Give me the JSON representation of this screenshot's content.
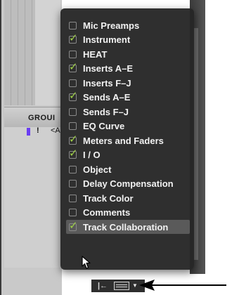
{
  "groups": {
    "header": "GROUI",
    "row_flag": "!",
    "row_name": "<A"
  },
  "menu": {
    "items": [
      {
        "label": "Mic Preamps",
        "checked": false
      },
      {
        "label": "Instrument",
        "checked": true
      },
      {
        "label": "HEAT",
        "checked": false
      },
      {
        "label": "Inserts A–E",
        "checked": true
      },
      {
        "label": "Inserts F–J",
        "checked": false
      },
      {
        "label": "Sends A–E",
        "checked": true
      },
      {
        "label": "Sends F–J",
        "checked": false
      },
      {
        "label": "EQ Curve",
        "checked": false
      },
      {
        "label": "Meters and Faders",
        "checked": true
      },
      {
        "label": "I / O",
        "checked": true
      },
      {
        "label": "Object",
        "checked": false
      },
      {
        "label": "Delay Compensation",
        "checked": false
      },
      {
        "label": "Track Color",
        "checked": false
      },
      {
        "label": "Comments",
        "checked": false
      },
      {
        "label": "Track Collaboration",
        "checked": true,
        "highlighted": true
      }
    ]
  },
  "bottom_bar": {
    "narrow_button": "|←"
  },
  "colors": {
    "menu_bg": "#262626",
    "check": "#9ed047",
    "highlight": "#5a5a5a",
    "group_chip": "#6a3df2"
  }
}
